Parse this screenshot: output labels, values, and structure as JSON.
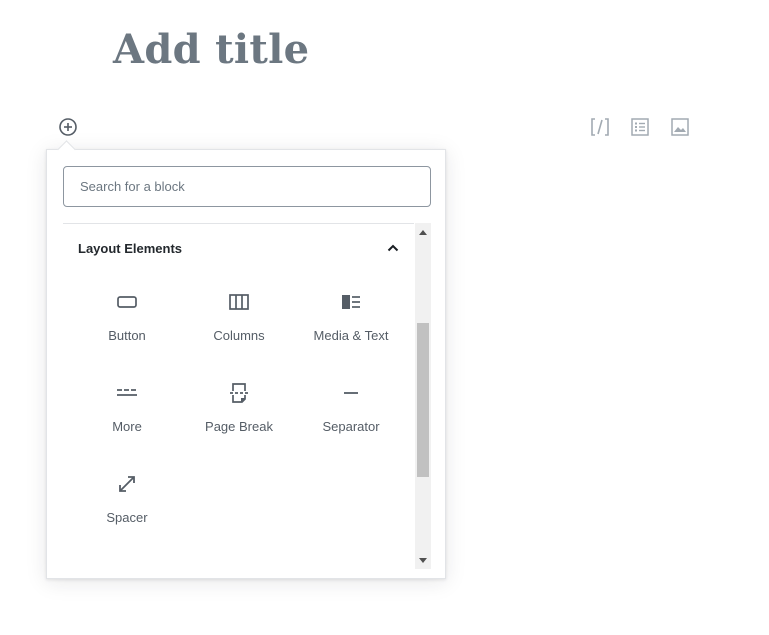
{
  "editor": {
    "title_placeholder": "Add title"
  },
  "toolbar": {
    "inserter_icon": "plus-circle-icon",
    "quick_blocks": [
      {
        "name": "shortcode",
        "icon": "shortcode-icon"
      },
      {
        "name": "list",
        "icon": "list-icon"
      },
      {
        "name": "image",
        "icon": "image-icon"
      }
    ]
  },
  "inserter": {
    "search_placeholder": "Search for a block",
    "panel": {
      "title": "Layout Elements",
      "expanded": true,
      "blocks": [
        {
          "label": "Button",
          "icon": "button-icon"
        },
        {
          "label": "Columns",
          "icon": "columns-icon"
        },
        {
          "label": "Media & Text",
          "icon": "media-text-icon"
        },
        {
          "label": "More",
          "icon": "more-icon"
        },
        {
          "label": "Page Break",
          "icon": "page-break-icon"
        },
        {
          "label": "Separator",
          "icon": "separator-icon"
        },
        {
          "label": "Spacer",
          "icon": "spacer-icon"
        }
      ]
    }
  },
  "colors": {
    "title": "#6c7781",
    "icon": "#555d66",
    "icon_light": "#a2aab2",
    "border": "#e2e4e7"
  }
}
